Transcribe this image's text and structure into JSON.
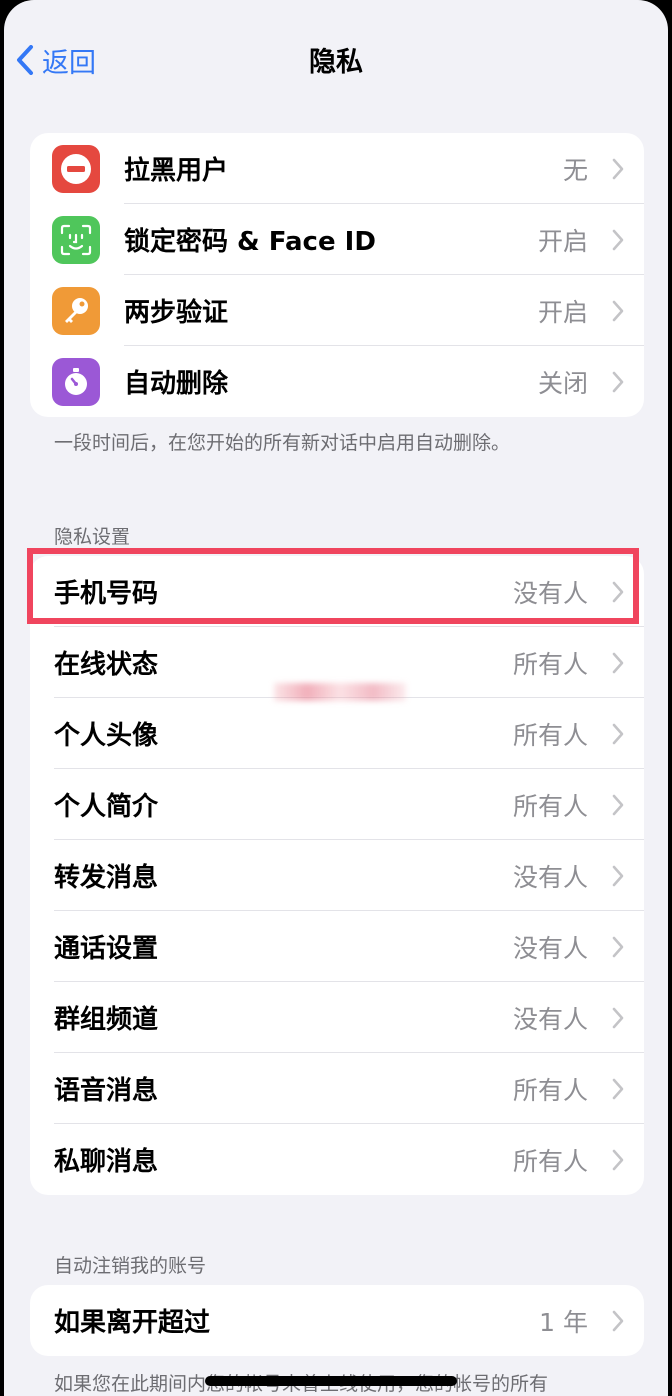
{
  "nav": {
    "back_label": "返回",
    "title": "隐私"
  },
  "security": {
    "items": [
      {
        "label": "拉黑用户",
        "value": "无",
        "icon": "blocked-icon",
        "color": "#e5483f"
      },
      {
        "label": "锁定密码 & Face ID",
        "value": "开启",
        "icon": "face-id-icon",
        "color": "#4fc65b"
      },
      {
        "label": "两步验证",
        "value": "开启",
        "icon": "key-icon",
        "color": "#f09a37"
      },
      {
        "label": "自动删除",
        "value": "关闭",
        "icon": "timer-icon",
        "color": "#9b58d6"
      }
    ],
    "footer": "一段时间后，在您开始的所有新对话中启用自动删除。"
  },
  "privacy": {
    "header": "隐私设置",
    "items": [
      {
        "label": "手机号码",
        "value": "没有人"
      },
      {
        "label": "在线状态",
        "value": "所有人"
      },
      {
        "label": "个人头像",
        "value": "所有人"
      },
      {
        "label": "个人简介",
        "value": "所有人"
      },
      {
        "label": "转发消息",
        "value": "没有人"
      },
      {
        "label": "通话设置",
        "value": "没有人"
      },
      {
        "label": "群组频道",
        "value": "没有人"
      },
      {
        "label": "语音消息",
        "value": "所有人"
      },
      {
        "label": "私聊消息",
        "value": "所有人"
      }
    ]
  },
  "account": {
    "header": "自动注销我的账号",
    "label": "如果离开超过",
    "value": "1 年",
    "footer": "如果您在此期间内您的帐号未曾上线使用，您的帐号的所有"
  },
  "colors": {
    "accent": "#3478f6",
    "highlight": "#f0455e"
  }
}
